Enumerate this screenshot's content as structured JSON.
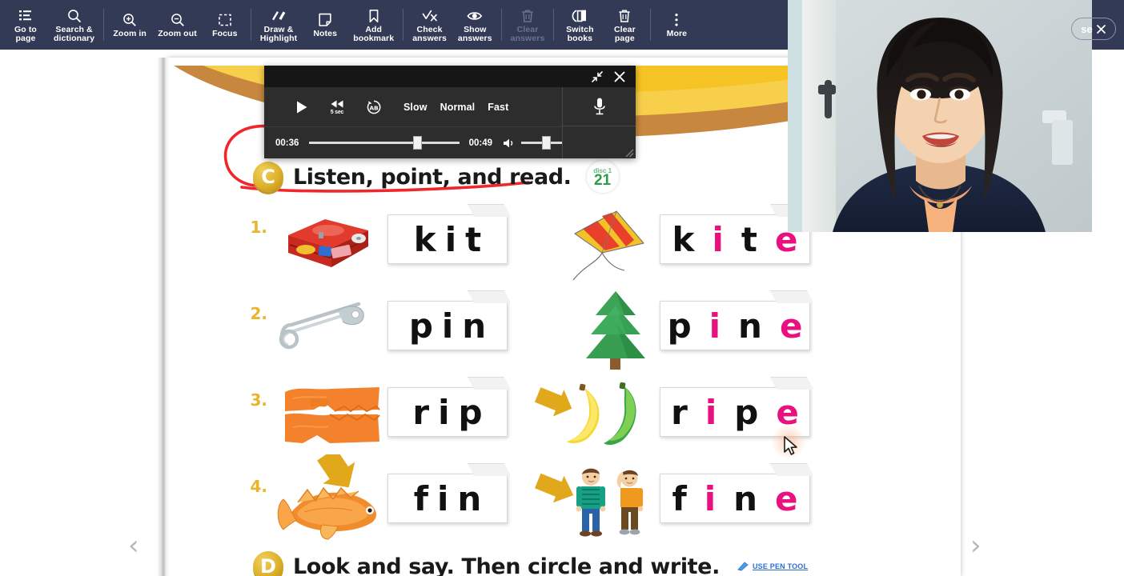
{
  "toolbar": {
    "items": [
      {
        "label": "Go to\npage",
        "icon": "list-icon",
        "disabled": false
      },
      {
        "label": "Search &\ndictionary",
        "icon": "search-icon",
        "disabled": false
      },
      {
        "label": "Zoom in",
        "icon": "zoom-in-icon",
        "disabled": false
      },
      {
        "label": "Zoom out",
        "icon": "zoom-out-icon",
        "disabled": false
      },
      {
        "label": "Focus",
        "icon": "focus-icon",
        "disabled": false
      },
      {
        "label": "Draw &\nHighlight",
        "icon": "pen-highlight-icon",
        "disabled": false
      },
      {
        "label": "Notes",
        "icon": "note-icon",
        "disabled": false
      },
      {
        "label": "Add\nbookmark",
        "icon": "bookmark-icon",
        "disabled": false
      },
      {
        "label": "Check\nanswers",
        "icon": "check-x-icon",
        "disabled": false
      },
      {
        "label": "Show\nanswers",
        "icon": "eye-icon",
        "disabled": false
      },
      {
        "label": "Clear\nanswers",
        "icon": "trash-icon",
        "disabled": true
      },
      {
        "label": "Switch\nbooks",
        "icon": "switch-books-icon",
        "disabled": false
      },
      {
        "label": "Clear\npage",
        "icon": "trash-icon",
        "disabled": false
      },
      {
        "label": "More",
        "icon": "more-vertical-icon",
        "disabled": false
      }
    ],
    "background_color": "#333a56"
  },
  "player": {
    "play_label": "play-button",
    "rewind_label": "5 sec",
    "ab_label": "AB",
    "speeds": [
      "Slow",
      "Normal",
      "Fast"
    ],
    "current_time": "00:36",
    "total_time": "00:49",
    "progress_percent": 72,
    "volume_percent": 55,
    "mic_label": "microphone",
    "minimize_label": "minimize",
    "close_label": "close"
  },
  "video": {
    "close_label": "se",
    "close_icon": "close-icon"
  },
  "page": {
    "sections": [
      {
        "letter": "C",
        "title": "Listen, point, and read.",
        "disc_label": "disc 1",
        "disc_number": "21",
        "accent_color": "#e8117f"
      },
      {
        "letter": "D",
        "title": "Look and say. Then circle and write.",
        "pen_tool_label": "USE PEN TOOL"
      }
    ],
    "rows": [
      {
        "num": "1.",
        "left_pic": "toolkit-box-image",
        "left_word": "kit",
        "right_pic": "kite-image",
        "right_word": "kite",
        "highlight": [
          "i",
          "e"
        ]
      },
      {
        "num": "2.",
        "left_pic": "safety-pin-image",
        "left_word": "pin",
        "right_pic": "pine-tree-image",
        "right_word": "pine",
        "highlight": [
          "i",
          "e"
        ]
      },
      {
        "num": "3.",
        "left_pic": "ripped-cloth-image",
        "left_word": "rip",
        "right_pic": "ripe-bananas-image",
        "right_word": "ripe",
        "highlight": [
          "i",
          "e"
        ]
      },
      {
        "num": "4.",
        "left_pic": "fish-fin-image",
        "left_word": "fin",
        "right_pic": "fine-boys-image",
        "right_word": "fine",
        "highlight": [
          "i",
          "e"
        ]
      }
    ],
    "prev_label": "‹",
    "next_label": "›"
  }
}
